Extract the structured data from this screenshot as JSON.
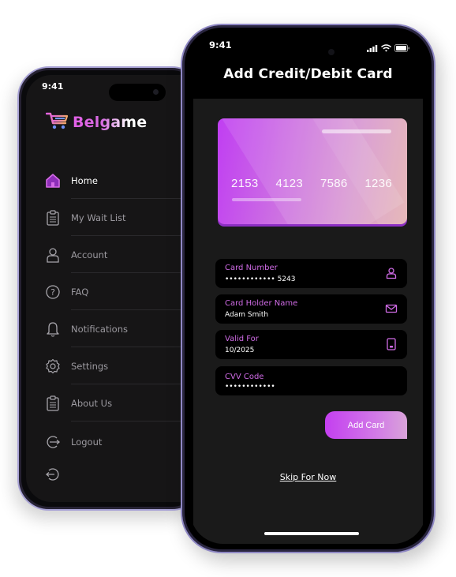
{
  "back_phone": {
    "status_time": "9:41",
    "brand": {
      "name": "Belgame",
      "icon": "cart-icon"
    },
    "menu": [
      {
        "label": "Home",
        "icon": "home-icon",
        "active": true
      },
      {
        "label": "My Wait List",
        "icon": "clipboard-icon",
        "active": false
      },
      {
        "label": "Account",
        "icon": "user-icon",
        "active": false
      },
      {
        "label": "FAQ",
        "icon": "question-icon",
        "active": false
      },
      {
        "label": "Notifications",
        "icon": "bell-icon",
        "active": false
      },
      {
        "label": "Settings",
        "icon": "gear-icon",
        "active": false
      },
      {
        "label": "About Us",
        "icon": "clipboard-icon",
        "active": false
      },
      {
        "label": "Logout",
        "icon": "logout-icon",
        "active": false
      }
    ],
    "extra_icon": "logout-icon"
  },
  "front_phone": {
    "status_time": "9:41",
    "title": "Add Credit/Debit Card",
    "card": {
      "groups": [
        "2153",
        "4123",
        "7586",
        "1236"
      ]
    },
    "fields": [
      {
        "label": "Card Number",
        "value": "•••••••••••• 5243",
        "icon": "user-icon"
      },
      {
        "label": "Card Holder Name",
        "value": "Adam Smith",
        "icon": "mail-icon"
      },
      {
        "label": "Valid For",
        "value": "10/2025",
        "icon": "card-icon"
      },
      {
        "label": "CVV Code",
        "value": "••••••••••••",
        "icon": ""
      }
    ],
    "add_button": "Add Card",
    "skip_link": "Skip For Now"
  },
  "colors": {
    "accent": "#d06be6",
    "accent_strong": "#c03ef2",
    "background": "#1a1a1a"
  }
}
